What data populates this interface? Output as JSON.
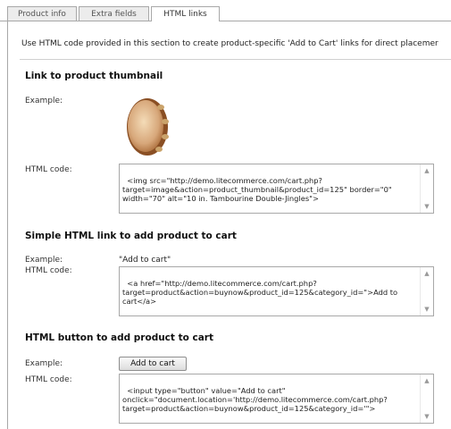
{
  "tabs": [
    {
      "label": "Product info",
      "active": false
    },
    {
      "label": "Extra fields",
      "active": false
    },
    {
      "label": "HTML links",
      "active": true
    }
  ],
  "description": "Use HTML code provided in this section to create product-specific 'Add to Cart' links for direct placemer",
  "sections": {
    "thumbnail": {
      "title": "Link to product thumbnail",
      "example_label": "Example:",
      "code_label": "HTML code:",
      "code": "<img src=\"http://demo.litecommerce.com/cart.php?\ntarget=image&action=product_thumbnail&product_id=125\" border=\"0\"\nwidth=\"70\" alt=\"10 in. Tambourine Double-Jingles\">",
      "image_icon": "tambourine-thumbnail"
    },
    "link": {
      "title": "Simple HTML link to add product to cart",
      "example_label": "Example:",
      "example_value": "\"Add to cart\"",
      "code_label": "HTML code:",
      "code": "<a href=\"http://demo.litecommerce.com/cart.php?\ntarget=product&action=buynow&product_id=125&category_id=\">Add to\ncart</a>"
    },
    "button": {
      "title": "HTML button to add product to cart",
      "example_label": "Example:",
      "example_button": "Add to cart",
      "code_label": "HTML code:",
      "code": "<input type=\"button\" value=\"Add to cart\"\nonclick=\"document.location='http://demo.litecommerce.com/cart.php?\ntarget=product&action=buynow&product_id=125&category_id='\">"
    }
  },
  "scroll_icons": {
    "up": "▲",
    "down": "▼"
  },
  "colors": {
    "border": "#a8a8a8",
    "tab_bg": "#ececec",
    "active_tab_bg": "#ffffff"
  }
}
